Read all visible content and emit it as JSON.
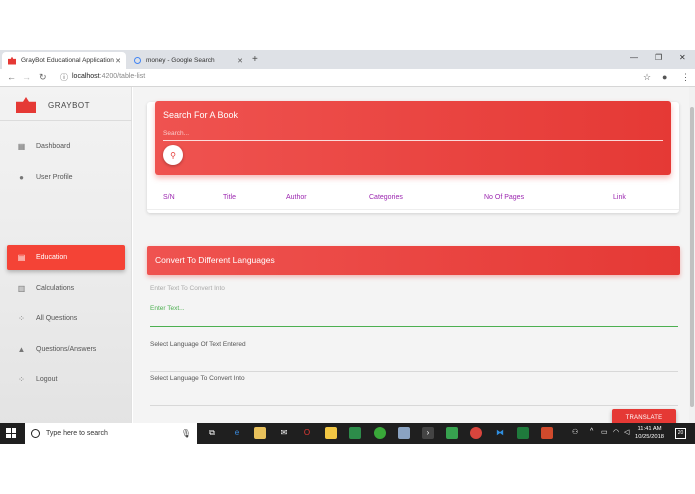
{
  "browser": {
    "tabs": [
      {
        "title": "GrayBot Educational Application",
        "active": true
      },
      {
        "title": "money - Google Search",
        "active": false
      }
    ],
    "new_tab": "+",
    "url_host": "localhost",
    "url_path": ":4200/table-list"
  },
  "app": {
    "brand": "GRAYBOT",
    "accent_color": "#e53935",
    "nav": [
      {
        "label": "Dashboard",
        "icon": "dashboard-icon"
      },
      {
        "label": "User Profile",
        "icon": "person-icon"
      },
      {
        "label": "Education",
        "icon": "clipboard-icon",
        "active": true
      },
      {
        "label": "Calculations",
        "icon": "library-icon"
      },
      {
        "label": "All Questions",
        "icon": "bubble-icon"
      },
      {
        "label": "Questions/Answers",
        "icon": "bell-icon"
      },
      {
        "label": "Logout",
        "icon": "bubble-icon"
      }
    ]
  },
  "search_card": {
    "title": "Search For A Book",
    "placeholder": "Search...",
    "columns": [
      "S/N",
      "Title",
      "Author",
      "Categories",
      "No Of Pages",
      "Link"
    ]
  },
  "convert_card": {
    "title": "Convert To Different Languages",
    "input_label": "Enter Text To Convert Into",
    "input_placeholder": "Enter Text...",
    "source_lang_label": "Select Language Of Text Entered",
    "target_lang_label": "Select Language To Convert Into",
    "translate_button": "TRANSLATE"
  },
  "taskbar": {
    "search_placeholder": "Type here to search",
    "time": "11:41 AM",
    "date": "10/25/2018",
    "notifications": "20"
  }
}
